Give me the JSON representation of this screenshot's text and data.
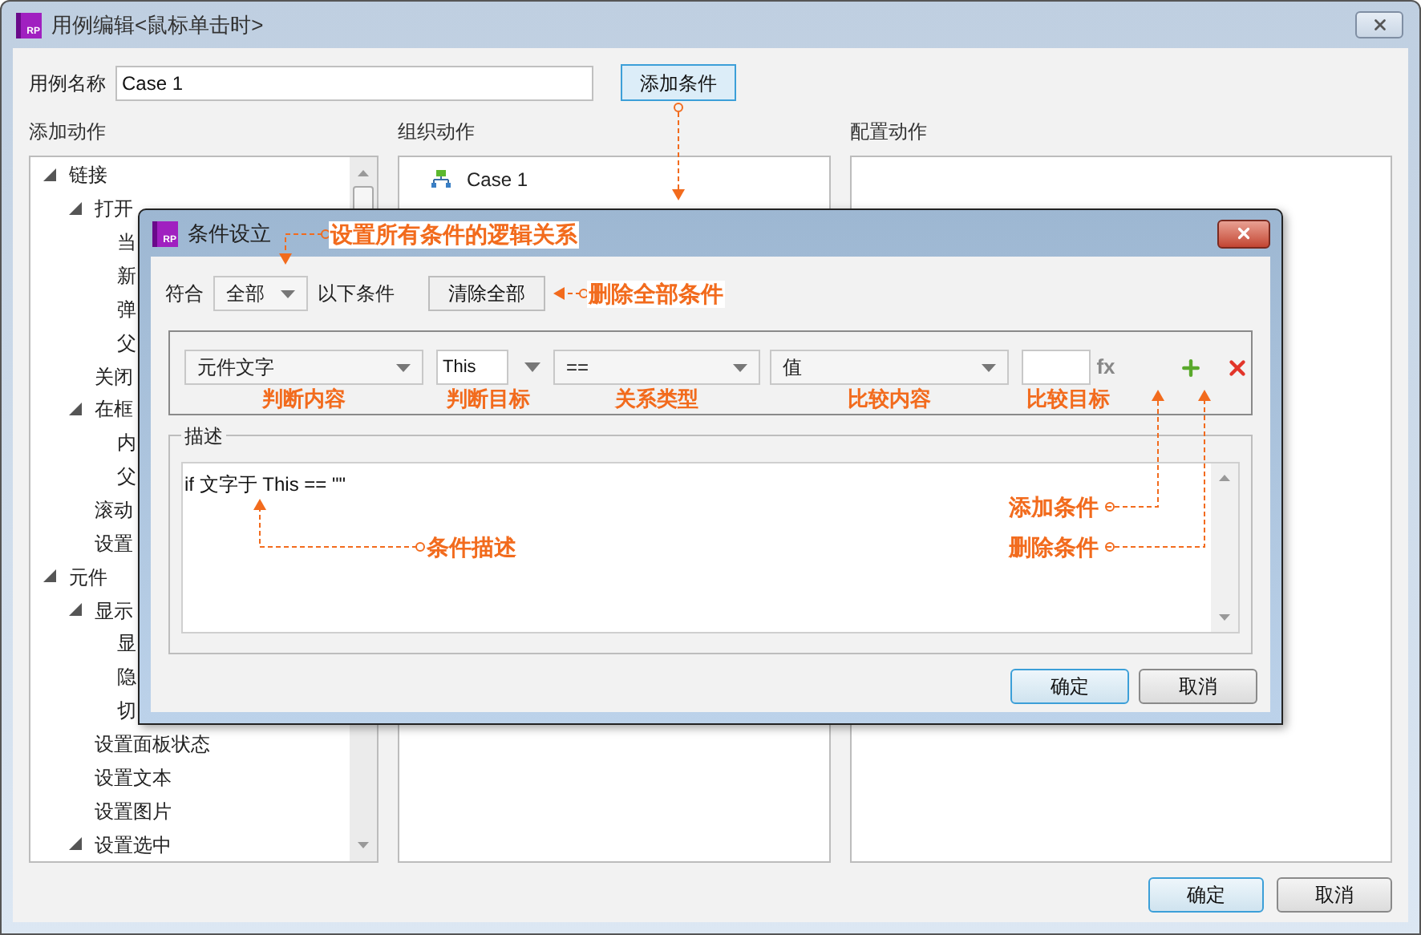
{
  "window": {
    "icon_label": "RP",
    "title": "用例编辑<鼠标单击时>",
    "case_name_label": "用例名称",
    "case_name": "Case 1",
    "add_condition_button": "添加条件"
  },
  "panels": [
    {
      "title": "添加动作"
    },
    {
      "title": "组织动作"
    },
    {
      "title": "配置动作"
    }
  ],
  "action_tree": [
    {
      "label": "链接",
      "expanded": true,
      "children": [
        {
          "label": "打开",
          "expanded": true,
          "children": [
            {
              "label": "当"
            },
            {
              "label": "新"
            },
            {
              "label": "弹"
            },
            {
              "label": "父"
            }
          ]
        },
        {
          "label": "关闭"
        },
        {
          "label": "在框",
          "expanded": true,
          "children": [
            {
              "label": "内"
            },
            {
              "label": "父"
            }
          ]
        },
        {
          "label": "滚动"
        },
        {
          "label": "设置"
        }
      ]
    },
    {
      "label": "元件",
      "expanded": true,
      "children": [
        {
          "label": "显示",
          "expanded": true,
          "children": [
            {
              "label": "显"
            },
            {
              "label": "隐"
            },
            {
              "label": "切"
            }
          ]
        },
        {
          "label": "设置面板状态"
        },
        {
          "label": "设置文本"
        },
        {
          "label": "设置图片"
        },
        {
          "label": "设置选中",
          "expanded": true
        }
      ]
    }
  ],
  "organize_tree": [
    {
      "label": "Case 1"
    }
  ],
  "buttons": [
    "确定",
    "取消"
  ],
  "condition_dialog": {
    "icon_label": "RP",
    "title": "条件设立",
    "match_label": "符合",
    "match_value": "全部",
    "match_suffix": "以下条件",
    "clear_button": "清除全部",
    "condition": [
      {
        "kind": "select",
        "value": "元件文字",
        "annotation": "判断内容"
      },
      {
        "kind": "input-dropdown",
        "value": "This",
        "annotation": "判断目标"
      },
      {
        "kind": "select",
        "value": "==",
        "annotation": "关系类型"
      },
      {
        "kind": "select",
        "value": "值",
        "annotation": "比较内容"
      },
      {
        "kind": "fx-input",
        "fx_label": "fx",
        "annotation": "比较目标"
      }
    ],
    "description_label": "描述",
    "description": "if 文字于 This == \"\"",
    "buttons": [
      "确定",
      "取消"
    ]
  },
  "annotations": [
    {
      "text": "设置所有条件的逻辑关系"
    },
    {
      "text": "删除全部条件"
    },
    {
      "text": "添加条件"
    },
    {
      "text": "删除条件"
    },
    {
      "text": "条件描述"
    }
  ]
}
